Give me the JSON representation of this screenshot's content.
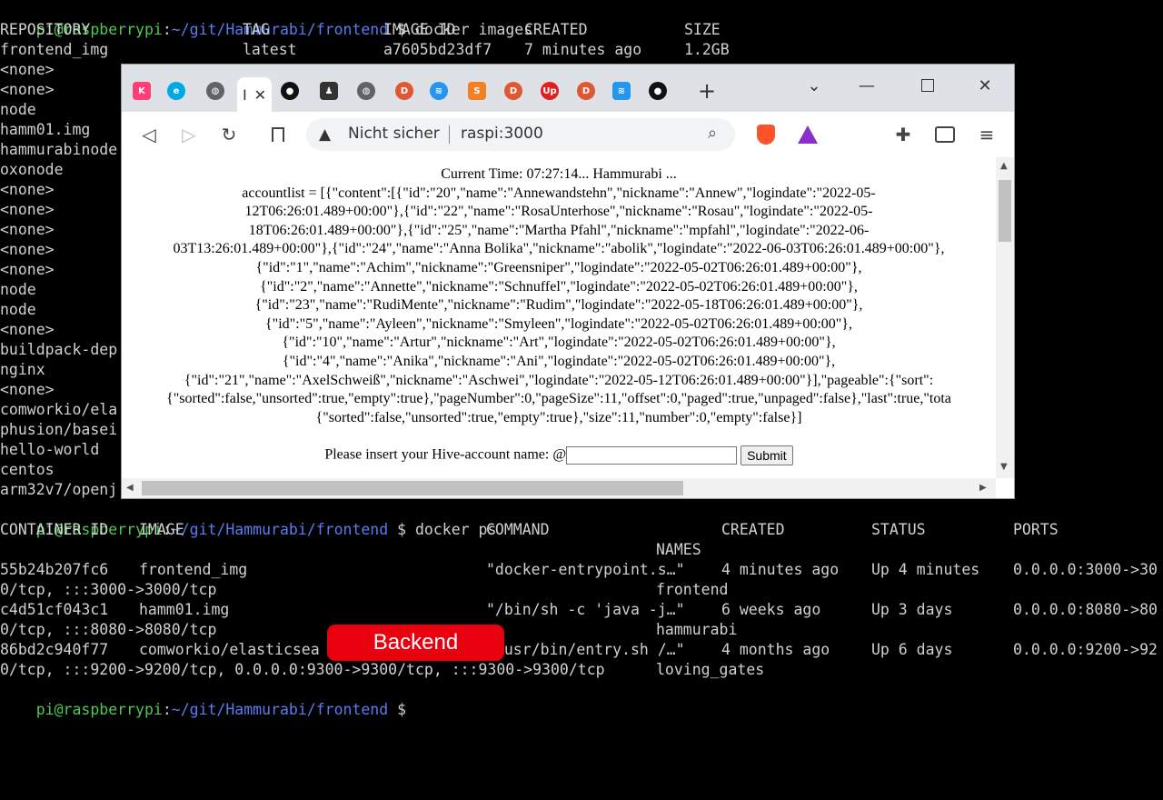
{
  "terminal": {
    "prompt1": {
      "user": "pi@raspberrypi",
      "colon": ":",
      "path": "~/git/Hammurabi/frontend",
      "dollar": " $ ",
      "cmd": "docker images"
    },
    "images_header": {
      "repo": "REPOSITORY",
      "tag": "TAG",
      "id": "IMAGE ID",
      "created": "CREATED",
      "size": "SIZE"
    },
    "image_first": {
      "repo": "frontend_img",
      "tag": "latest",
      "id": "a7605bd23df7",
      "created": "7 minutes ago",
      "size": "1.2GB"
    },
    "image_repos": [
      "<none>",
      "<none>",
      "node",
      "hamm01.img",
      "hammurabinode",
      "oxonode",
      "<none>",
      "<none>",
      "<none>",
      "<none>",
      "<none>",
      "node",
      "node",
      "<none>",
      "buildpack-dep",
      "nginx",
      "<none>",
      "comworkio/ela",
      "phusion/basei",
      "hello-world",
      "centos",
      "arm32v7/openj"
    ],
    "prompt2": {
      "user": "pi@raspberrypi",
      "colon": ":",
      "path": "~/git/Hammurabi/frontend",
      "dollar": " $ ",
      "cmd": "docker ps"
    },
    "ps_header": {
      "cid": "CONTAINER ID",
      "image": "IMAGE",
      "command": "COMMAND",
      "created": "CREATED",
      "status": "STATUS",
      "ports": "PORTS",
      "names": "NAMES"
    },
    "ps_rows": [
      {
        "cid": "55b24b207fc6",
        "image": "frontend_img",
        "command": "\"docker-entrypoint.s…\"",
        "created": "4 minutes ago",
        "status": "Up 4 minutes",
        "ports": "0.0.0.0:3000->30",
        "wrap": "0/tcp, :::3000->3000/tcp",
        "name": "frontend"
      },
      {
        "cid": "c4d51cf043c1",
        "image": "hamm01.img",
        "command": "\"/bin/sh -c 'java -j…\"",
        "created": "6 weeks ago",
        "status": "Up 3 days",
        "ports": "0.0.0.0:8080->80",
        "wrap": "0/tcp, :::8080->8080/tcp",
        "name": "hammurabi"
      },
      {
        "cid": "86bd2c940f77",
        "image": "comworkio/elasticsea",
        "command": "\"/usr/bin/entry.sh /…\"",
        "created": "4 months ago",
        "status": "Up 6 days",
        "ports": "0.0.0.0:9200->92",
        "wrap": "0/tcp, :::9200->9200/tcp, 0.0.0.0:9300->9300/tcp, :::9300->9300/tcp",
        "name": "loving_gates"
      }
    ],
    "prompt3": {
      "user": "pi@raspberrypi",
      "colon": ":",
      "path": "~/git/Hammurabi/frontend",
      "dollar": " $ "
    }
  },
  "browser": {
    "tabs": [
      {
        "icon": "k-icon",
        "glyph": "K",
        "color": "#ff3d77"
      },
      {
        "icon": "elastic-icon",
        "glyph": "e",
        "color": "#00a9e5"
      },
      {
        "icon": "globe-icon",
        "glyph": "🌐",
        "color": "#5f6368"
      },
      {
        "icon": "github-icon",
        "glyph": "●",
        "color": "#111111"
      },
      {
        "icon": "linux-icon",
        "glyph": "🐧",
        "color": "#333333"
      },
      {
        "icon": "globe-icon",
        "glyph": "🌐",
        "color": "#5f6368"
      },
      {
        "icon": "duckduckgo-icon",
        "glyph": "D",
        "color": "#de5833"
      },
      {
        "icon": "docker-icon",
        "glyph": "🐳",
        "color": "#2496ed"
      },
      {
        "icon": "stackoverflow-icon",
        "glyph": "S",
        "color": "#f48024"
      },
      {
        "icon": "duckduckgo-icon",
        "glyph": "D",
        "color": "#de5833"
      },
      {
        "icon": "upwork-icon",
        "glyph": "Up",
        "color": "#e02020"
      },
      {
        "icon": "duckduckgo-icon",
        "glyph": "D",
        "color": "#de5833"
      },
      {
        "icon": "docker-icon",
        "glyph": "🐳",
        "color": "#2496ed"
      },
      {
        "icon": "github-icon",
        "glyph": "●",
        "color": "#111111"
      }
    ],
    "active_tab_label": "I",
    "address": {
      "security": "Nicht sicher",
      "url": "raspi:3000"
    },
    "page": {
      "lines": [
        "Current Time: 07:27:14... Hammurabi ...",
        "accountlist = [{\"content\":[{\"id\":\"20\",\"name\":\"Annewandstehn\",\"nickname\":\"Annew\",\"logindate\":\"2022-05-",
        "12T06:26:01.489+00:00\"},{\"id\":\"22\",\"name\":\"RosaUnterhose\",\"nickname\":\"Rosau\",\"logindate\":\"2022-05-",
        "18T06:26:01.489+00:00\"},{\"id\":\"25\",\"name\":\"Martha Pfahl\",\"nickname\":\"mpfahl\",\"logindate\":\"2022-06-",
        "03T13:26:01.489+00:00\"},{\"id\":\"24\",\"name\":\"Anna Bolika\",\"nickname\":\"abolik\",\"logindate\":\"2022-06-03T06:26:01.489+00:00\"},",
        "{\"id\":\"1\",\"name\":\"Achim\",\"nickname\":\"Greensniper\",\"logindate\":\"2022-05-02T06:26:01.489+00:00\"},",
        "{\"id\":\"2\",\"name\":\"Annette\",\"nickname\":\"Schnuffel\",\"logindate\":\"2022-05-02T06:26:01.489+00:00\"},",
        "{\"id\":\"23\",\"name\":\"RudiMente\",\"nickname\":\"Rudim\",\"logindate\":\"2022-05-18T06:26:01.489+00:00\"},",
        "{\"id\":\"5\",\"name\":\"Ayleen\",\"nickname\":\"Smyleen\",\"logindate\":\"2022-05-02T06:26:01.489+00:00\"},",
        "{\"id\":\"10\",\"name\":\"Artur\",\"nickname\":\"Art\",\"logindate\":\"2022-05-02T06:26:01.489+00:00\"},",
        "{\"id\":\"4\",\"name\":\"Anika\",\"nickname\":\"Ani\",\"logindate\":\"2022-05-02T06:26:01.489+00:00\"},",
        "{\"id\":\"21\",\"name\":\"AxelSchweiß\",\"nickname\":\"Aschwei\",\"logindate\":\"2022-05-12T06:26:01.489+00:00\"}],\"pageable\":{\"sort\":",
        "{\"sorted\":false,\"unsorted\":true,\"empty\":true},\"pageNumber\":0,\"pageSize\":11,\"offset\":0,\"paged\":true,\"unpaged\":false},\"last\":true,\"tota",
        "{\"sorted\":false,\"unsorted\":true,\"empty\":true},\"size\":11,\"number\":0,\"empty\":false}]"
      ],
      "prompt_label": "Please insert your Hive-account name: @",
      "submit_label": "Submit"
    }
  },
  "callout": {
    "label": "Backend",
    "color": "#e8000f"
  }
}
